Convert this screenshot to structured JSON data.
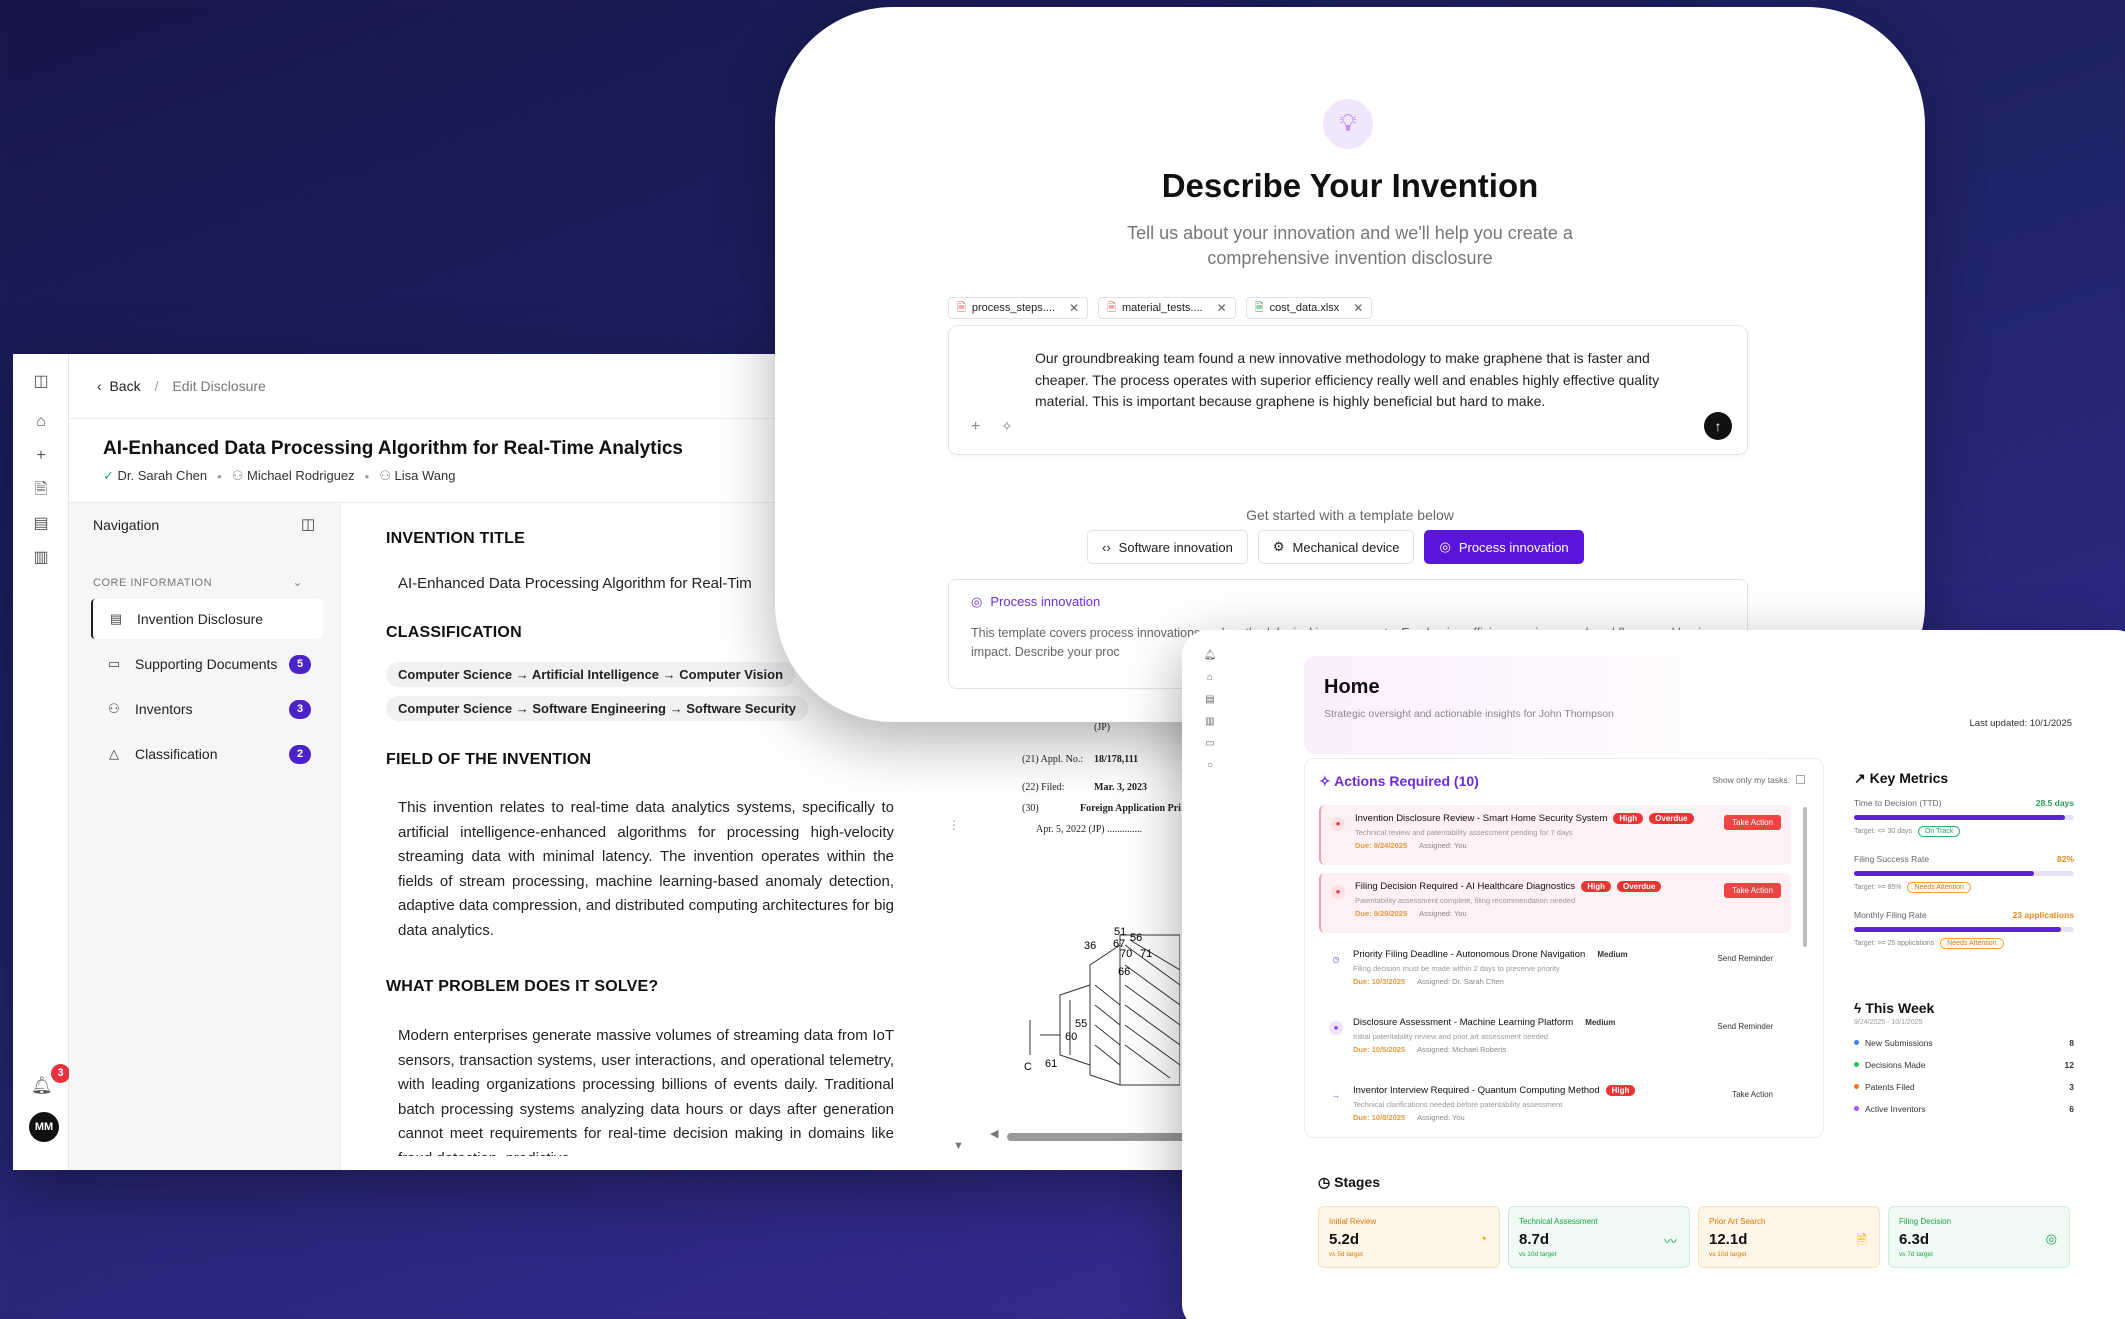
{
  "editor": {
    "back": "Back",
    "crumb_current": "Edit Disclosure",
    "title": "AI-Enhanced Data Processing Algorithm for Real-Time Analytics",
    "authors": [
      "Dr. Sarah Chen",
      "Michael Rodriguez",
      "Lisa Wang"
    ],
    "notifications": "3",
    "avatar": "MM",
    "nav": {
      "heading": "Navigation",
      "section": "CORE INFORMATION",
      "items": [
        {
          "label": "Invention Disclosure",
          "count": ""
        },
        {
          "label": "Supporting Documents",
          "count": "5"
        },
        {
          "label": "Inventors",
          "count": "3"
        },
        {
          "label": "Classification",
          "count": "2"
        }
      ]
    },
    "content": {
      "h_title": "INVENTION TITLE",
      "title_value": "AI-Enhanced Data Processing Algorithm for Real-Tim",
      "h_class": "CLASSIFICATION",
      "class_1": "Computer Science → Artificial Intelligence → Computer Vision",
      "class_2": "Computer Science → Software Engineering → Software Security",
      "h_field": "FIELD OF THE INVENTION",
      "field_text": "This invention relates to real-time data analytics systems, specifically to artificial intelligence-enhanced algorithms for processing high-velocity streaming data with minimal latency. The invention operates within the fields of stream processing, machine learning-based anomaly detection, adaptive data compression, and distributed computing architectures for big data analytics.",
      "h_problem": "WHAT PROBLEM DOES IT SOLVE?",
      "problem_text": "Modern enterprises generate massive volumes of streaming data from IoT sensors, transaction systems, user interactions, and operational telemetry, with leading organizations processing billions of events daily. Traditional batch processing systems analyzing data hours or days after generation cannot meet requirements for real-time decision making in domains like fraud detection, predictive"
    },
    "patent": {
      "jp": "(JP)",
      "appl_label": "(21)  Appl. No.:",
      "appl_value": "18/178,111",
      "filed_label": "(22)  Filed:",
      "filed_value": "Mar. 3, 2023",
      "foreign_label": "(30)",
      "foreign_value": "Foreign Application Pri",
      "priority": "Apr. 5, 2022   (JP) ..............",
      "refs": [
        "51",
        "36",
        "67",
        "56",
        "70",
        "71",
        "66",
        "55",
        "60",
        "61",
        "C"
      ]
    }
  },
  "invent": {
    "title": "Describe Your Invention",
    "subtitle": "Tell us about your innovation and we'll help you create a comprehensive invention disclosure",
    "files": [
      "process_steps....",
      "material_tests....",
      "cost_data.xlsx"
    ],
    "prompt": "Our groundbreaking team found a new innovative methodology to make graphene that is faster and cheaper. The process operates with superior efficiency really well and enables highly effective quality material. This is important because graphene is highly beneficial but hard to make.",
    "template_label": "Get started with a template below",
    "templates": [
      "Software innovation",
      "Mechanical device",
      "Process innovation"
    ],
    "selected_title": "Process innovation",
    "selected_text": "This template covers process innovations and methodological improvements. Emphasize efficiency gains, novel workflows, and business impact. Describe your proc"
  },
  "dashboard": {
    "title": "Home",
    "subtitle": "Strategic oversight and actionable insights for John Thompson",
    "updated": "Last updated: 10/1/2025",
    "actions_title": "Actions Required (10)",
    "filter_label": "Show only my tasks:",
    "tasks": [
      {
        "name": "Invention Disclosure Review - Smart Home Security System",
        "b1": "High",
        "b2": "Overdue",
        "desc": "Technical review and patentability assessment pending for 7 days",
        "due": "Due: 9/24/2025",
        "assigned": "Assigned: You",
        "action": "Take Action"
      },
      {
        "name": "Filing Decision Required - AI Healthcare Diagnostics",
        "b1": "High",
        "b2": "Overdue",
        "desc": "Patentability assessment complete, filing recommendation needed",
        "due": "Due: 9/29/2025",
        "assigned": "Assigned: You",
        "action": "Take Action"
      },
      {
        "name": "Priority Filing Deadline - Autonomous Drone Navigation",
        "b1": "Medium",
        "b2": "",
        "desc": "Filing decision must be made within 2 days to preserve priority",
        "due": "Due: 10/3/2025",
        "assigned": "Assigned: Dr. Sarah Chen",
        "action": "Send Reminder"
      },
      {
        "name": "Disclosure Assessment - Machine Learning Platform",
        "b1": "Medium",
        "b2": "",
        "desc": "Initial patentability review and prior art assessment needed",
        "due": "Due: 10/5/2025",
        "assigned": "Assigned: Michael Roberts",
        "action": "Send Reminder"
      },
      {
        "name": "Inventor Interview Required - Quantum Computing Method",
        "b1": "High",
        "b2": "",
        "desc": "Technical clarifications needed before patentability assessment",
        "due": "Due: 10/8/2025",
        "assigned": "Assigned: You",
        "action": "Take Action"
      }
    ],
    "metrics_title": "Key Metrics",
    "metrics": [
      {
        "label": "Time to Decision (TTD)",
        "value": "28.5 days",
        "fill": 0.96,
        "target": "Target: <= 30 days",
        "status": "On Track"
      },
      {
        "label": "Filing Success Rate",
        "value": "82%",
        "fill": 0.82,
        "target": "Target: >= 85%",
        "status": "Needs Attention"
      },
      {
        "label": "Monthly Filing Rate",
        "value": "23 applications",
        "fill": 0.94,
        "target": "Target: >= 25 applications",
        "status": "Needs Attention"
      }
    ],
    "week_title": "This Week",
    "week_dates": "9/24/2025 - 10/1/2025",
    "week": [
      {
        "label": "New Submissions",
        "value": "8"
      },
      {
        "label": "Decisions Made",
        "value": "12"
      },
      {
        "label": "Patents Filed",
        "value": "3"
      },
      {
        "label": "Active Inventors",
        "value": "6"
      }
    ],
    "stages_title": "Stages",
    "stages": [
      {
        "label": "Initial Review",
        "value": "5.2d",
        "target": "vs 5d target"
      },
      {
        "label": "Technical Assessment",
        "value": "8.7d",
        "target": "vs 10d target"
      },
      {
        "label": "Prior Art Search",
        "value": "12.1d",
        "target": "vs 10d target"
      },
      {
        "label": "Filing Decision",
        "value": "6.3d",
        "target": "vs 7d target"
      }
    ]
  },
  "colors": {
    "accent": "#5b14d9",
    "badge": "#4c22c9",
    "danger": "#ef4444",
    "success": "#22a35a",
    "warning": "#f0a23a"
  }
}
